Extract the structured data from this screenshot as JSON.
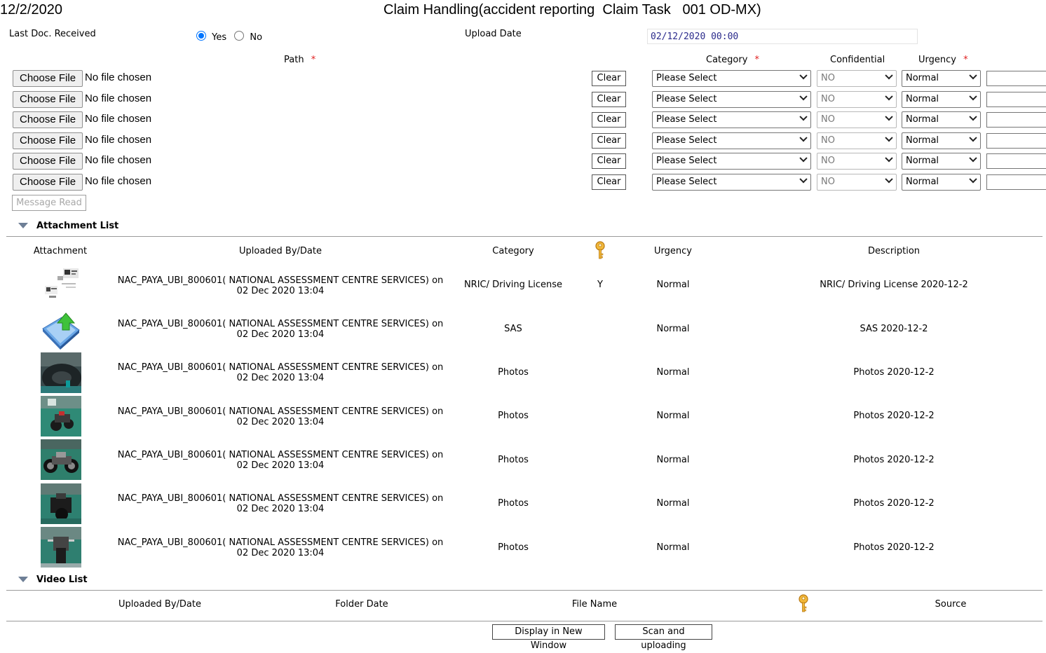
{
  "header": {
    "date": "12/2/2020",
    "title": "Claim Handling(accident reporting  Claim Task   001 OD-MX)"
  },
  "form": {
    "last_doc_label": "Last Doc. Received",
    "yes_label": "Yes",
    "no_label": "No",
    "last_doc_selected": "Yes",
    "upload_date_label": "Upload Date",
    "upload_date_value": "02/12/2020 00:00",
    "path_label": "Path",
    "category_label": "Category",
    "confidential_label": "Confidential",
    "urgency_label": "Urgency",
    "required_mark": "*"
  },
  "file_rows": [
    {
      "choose": "Choose File",
      "status": "No file chosen",
      "clear": "Clear",
      "category": "Please Select",
      "confidential": "NO",
      "urgency": "Normal"
    },
    {
      "choose": "Choose File",
      "status": "No file chosen",
      "clear": "Clear",
      "category": "Please Select",
      "confidential": "NO",
      "urgency": "Normal"
    },
    {
      "choose": "Choose File",
      "status": "No file chosen",
      "clear": "Clear",
      "category": "Please Select",
      "confidential": "NO",
      "urgency": "Normal"
    },
    {
      "choose": "Choose File",
      "status": "No file chosen",
      "clear": "Clear",
      "category": "Please Select",
      "confidential": "NO",
      "urgency": "Normal"
    },
    {
      "choose": "Choose File",
      "status": "No file chosen",
      "clear": "Clear",
      "category": "Please Select",
      "confidential": "NO",
      "urgency": "Normal"
    },
    {
      "choose": "Choose File",
      "status": "No file chosen",
      "clear": "Clear",
      "category": "Please Select",
      "confidential": "NO",
      "urgency": "Normal"
    }
  ],
  "message_read_label": "Message Read",
  "attachment_list": {
    "title": "Attachment List",
    "columns": {
      "attachment": "Attachment",
      "uploaded": "Uploaded By/Date",
      "category": "Category",
      "confidential_icon": "key-icon",
      "urgency": "Urgency",
      "description": "Description"
    },
    "rows": [
      {
        "thumb": "document-thumbnail",
        "uploader": "NAC_PAYA_UBI_800601( NATIONAL ASSESSMENT CENTRE SERVICES) on",
        "date": "02 Dec 2020 13:04",
        "category": "NRIC/ Driving License",
        "confidential": "Y",
        "urgency": "Normal",
        "description": "NRIC/ Driving License 2020-12-2"
      },
      {
        "thumb": "upload-file-icon",
        "uploader": "NAC_PAYA_UBI_800601( NATIONAL ASSESSMENT CENTRE SERVICES) on",
        "date": "02 Dec 2020 13:04",
        "category": "SAS",
        "confidential": "",
        "urgency": "Normal",
        "description": "SAS 2020-12-2"
      },
      {
        "thumb": "photo-tyre",
        "uploader": "NAC_PAYA_UBI_800601( NATIONAL ASSESSMENT CENTRE SERVICES) on",
        "date": "02 Dec 2020 13:04",
        "category": "Photos",
        "confidential": "",
        "urgency": "Normal",
        "description": "Photos 2020-12-2"
      },
      {
        "thumb": "photo-motorcycle",
        "uploader": "NAC_PAYA_UBI_800601( NATIONAL ASSESSMENT CENTRE SERVICES) on",
        "date": "02 Dec 2020 13:04",
        "category": "Photos",
        "confidential": "",
        "urgency": "Normal",
        "description": "Photos 2020-12-2"
      },
      {
        "thumb": "photo-motorcycle",
        "uploader": "NAC_PAYA_UBI_800601( NATIONAL ASSESSMENT CENTRE SERVICES) on",
        "date": "02 Dec 2020 13:04",
        "category": "Photos",
        "confidential": "",
        "urgency": "Normal",
        "description": "Photos 2020-12-2"
      },
      {
        "thumb": "photo-motorcycle",
        "uploader": "NAC_PAYA_UBI_800601( NATIONAL ASSESSMENT CENTRE SERVICES) on",
        "date": "02 Dec 2020 13:04",
        "category": "Photos",
        "confidential": "",
        "urgency": "Normal",
        "description": "Photos 2020-12-2"
      },
      {
        "thumb": "photo-motorcycle",
        "uploader": "NAC_PAYA_UBI_800601( NATIONAL ASSESSMENT CENTRE SERVICES) on",
        "date": "02 Dec 2020 13:04",
        "category": "Photos",
        "confidential": "",
        "urgency": "Normal",
        "description": "Photos 2020-12-2"
      }
    ]
  },
  "video_list": {
    "title": "Video List",
    "columns": {
      "uploaded": "Uploaded By/Date",
      "folder_date": "Folder Date",
      "file_name": "File Name",
      "confidential_icon": "key-icon",
      "source": "Source"
    }
  },
  "buttons": {
    "display_new_window": "Display in New Window",
    "scan_upload": "Scan and uploading"
  },
  "colors": {
    "required": "#e02020",
    "radio_accent": "#0075ff",
    "date_text": "#2b2b8c",
    "section_triangle": "#6e7f96",
    "key": "#e8a020"
  }
}
